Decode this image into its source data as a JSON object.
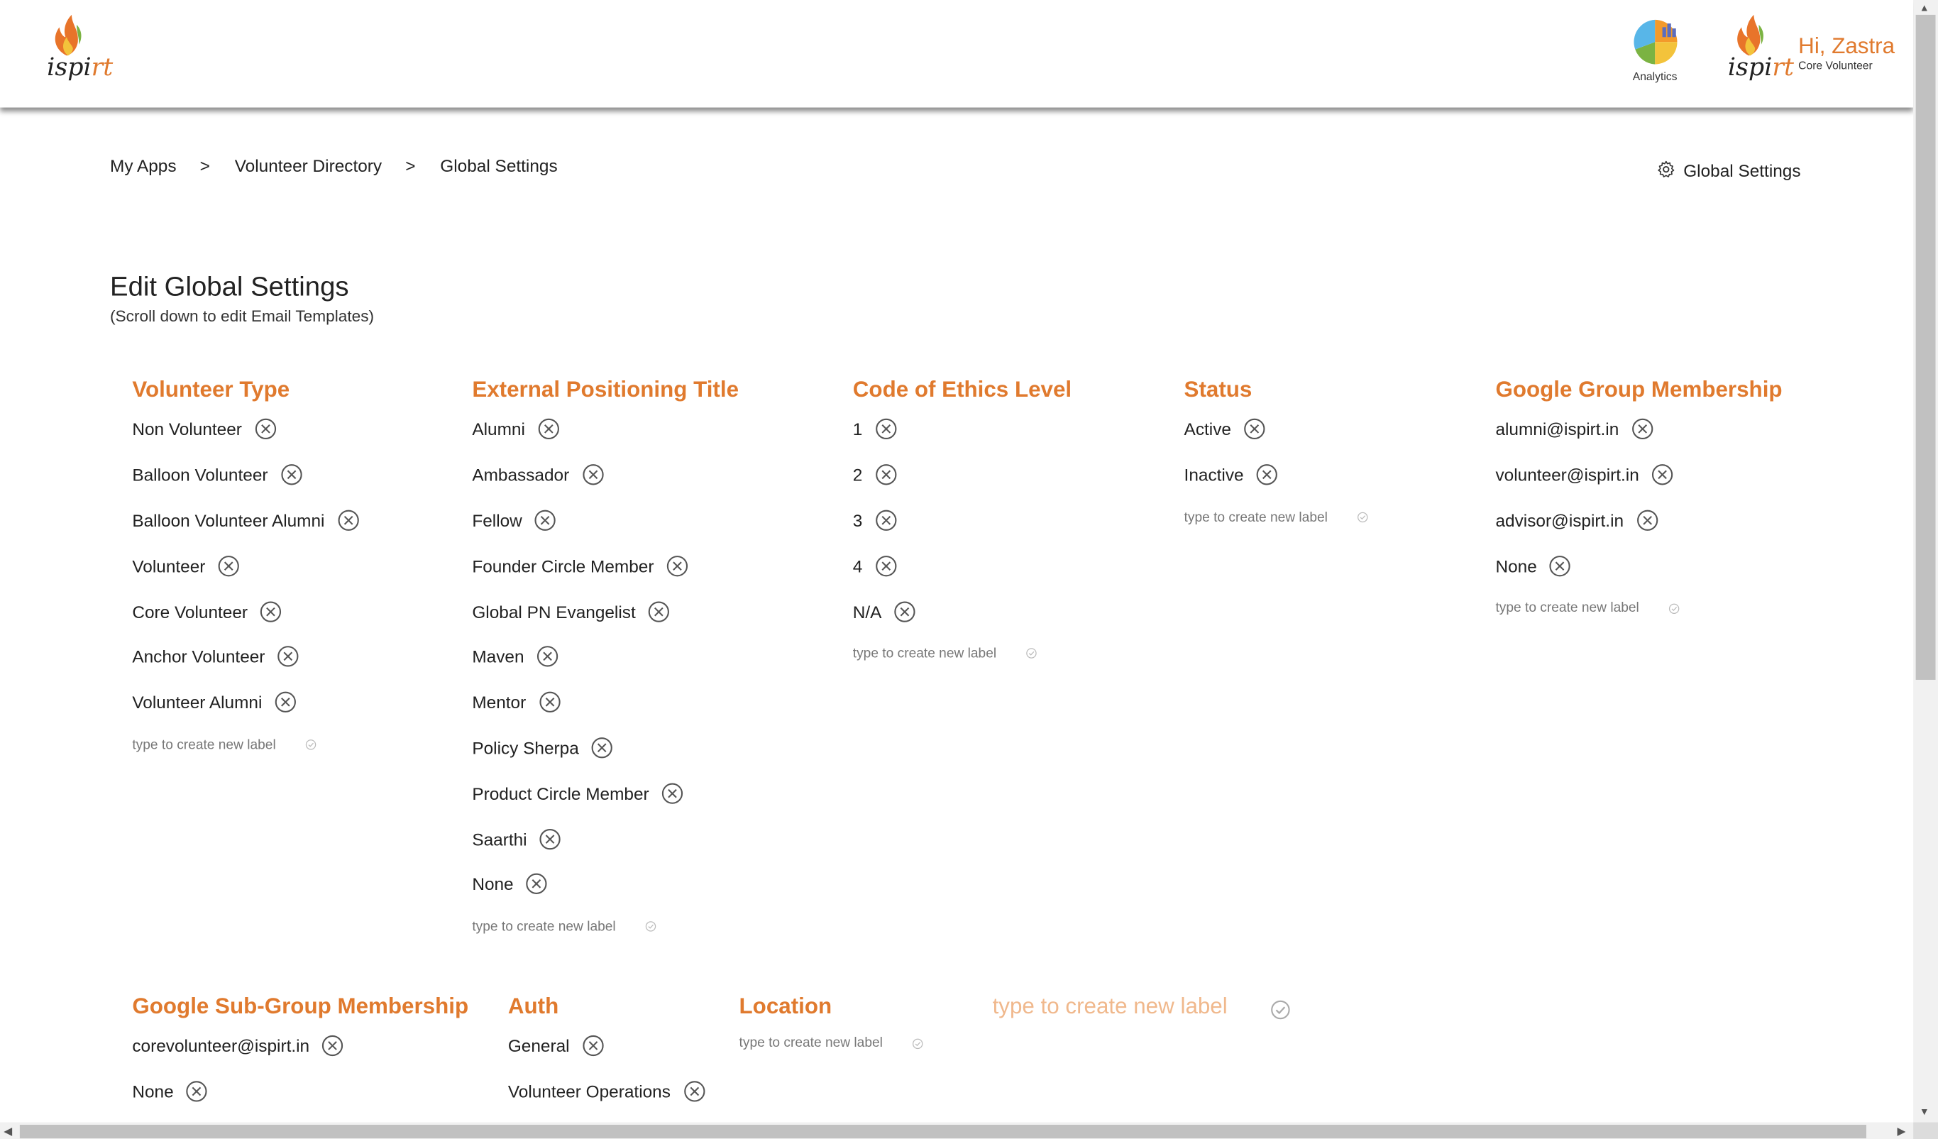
{
  "header": {
    "logo_text_black": "ispi",
    "logo_text_orange": "rt",
    "analytics_label": "Analytics",
    "greeting": "Hi, Zastra",
    "role": "Core Volunteer"
  },
  "breadcrumb": {
    "items": [
      "My Apps",
      "Volunteer Directory",
      "Global Settings"
    ],
    "separator": ">"
  },
  "settings_link": {
    "label": "Global Settings",
    "icon": "gear-icon"
  },
  "page": {
    "title": "Edit Global Settings",
    "subtitle": "(Scroll down to edit Email Templates)"
  },
  "new_label_placeholder": "type to create new label",
  "groups": [
    {
      "title": "Volunteer Type",
      "items": [
        "Non Volunteer",
        "Balloon Volunteer",
        "Balloon Volunteer Alumni",
        "Volunteer",
        "Core Volunteer",
        "Anchor Volunteer",
        "Volunteer Alumni"
      ]
    },
    {
      "title": "External Positioning Title",
      "items": [
        "Alumni",
        "Ambassador",
        "Fellow",
        "Founder Circle Member",
        "Global PN Evangelist",
        "Maven",
        "Mentor",
        "Policy Sherpa",
        "Product Circle Member",
        "Saarthi",
        "None"
      ]
    },
    {
      "title": "Code of Ethics Level",
      "items": [
        "1",
        "2",
        "3",
        "4",
        "N/A"
      ]
    },
    {
      "title": "Status",
      "items": [
        "Active",
        "Inactive"
      ]
    },
    {
      "title": "Google Group Membership",
      "items": [
        "alumni@ispirt.in",
        "volunteer@ispirt.in",
        "advisor@ispirt.in",
        "None"
      ]
    },
    {
      "title": "Google Sub-Group Membership",
      "items": [
        "corevolunteer@ispirt.in",
        "None"
      ]
    },
    {
      "title": "Auth",
      "items": [
        "General",
        "Volunteer Operations"
      ]
    },
    {
      "title": "Location",
      "items": []
    }
  ],
  "colors": {
    "accent": "#e07a2e",
    "placeholder_strong": "#f0b88c"
  }
}
